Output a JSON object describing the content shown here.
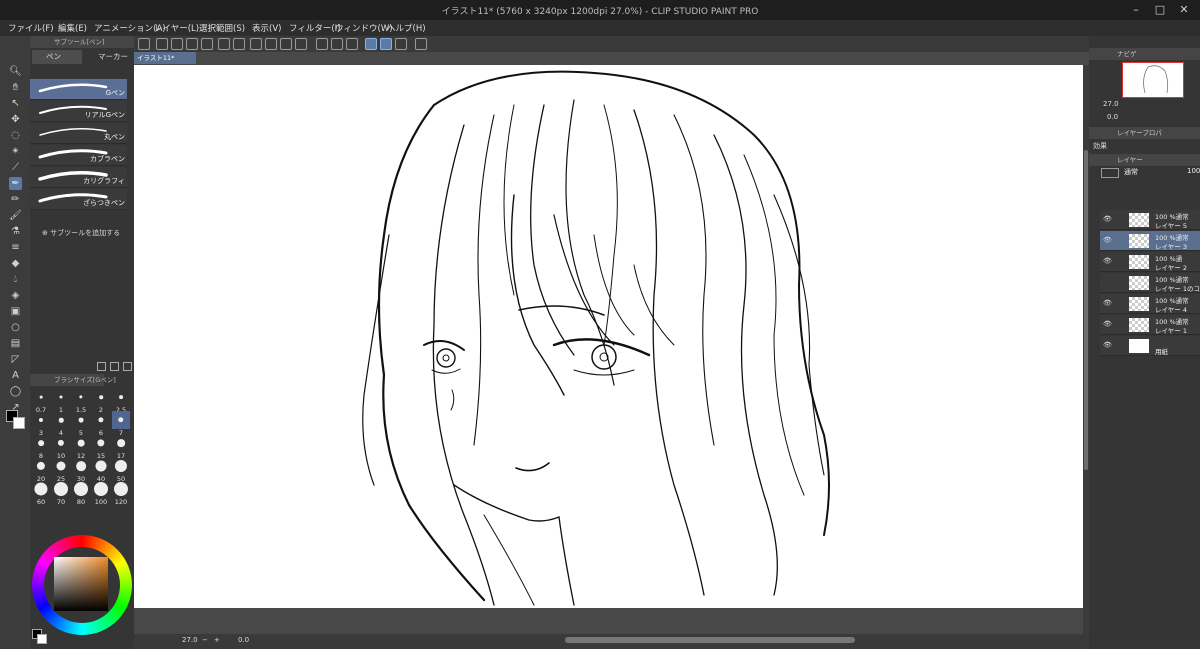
{
  "window": {
    "title": "イラスト11* (5760 x 3240px 1200dpi 27.0%) - CLIP STUDIO PAINT PRO"
  },
  "menu": [
    "ファイル(F)",
    "編集(E)",
    "アニメーション(A)",
    "レイヤー(L)",
    "選択範囲(S)",
    "表示(V)",
    "フィルター(I)",
    "ウィンドウ(W)",
    "ヘルプ(H)"
  ],
  "subtool_panel": {
    "header": "サブツール[ペン]",
    "tabs": [
      "ペン",
      "マーカー"
    ],
    "brushes": [
      "Gペン",
      "リアルGペン",
      "丸ペン",
      "カブラペン",
      "カリグラフィ",
      "ざらつきペン"
    ],
    "selected_brush": "Gペン",
    "add_label": "サブツールを追加する"
  },
  "brush_size_panel": {
    "header": "ブラシサイズ[Gペン]",
    "sizes": [
      "0.7",
      "1",
      "1.5",
      "2",
      "2.5",
      "3",
      "4",
      "5",
      "6",
      "7",
      "8",
      "10",
      "12",
      "15",
      "17",
      "20",
      "25",
      "30",
      "40",
      "50",
      "60",
      "70",
      "80",
      "100",
      "120"
    ],
    "selected": "7"
  },
  "canvas": {
    "tab_label": "イラスト11*",
    "content": "line drawing sketch"
  },
  "status_bar": {
    "zoom": "27.0",
    "rotation": "0.0"
  },
  "navigator": {
    "header": "ナビゲ",
    "zoom": "27.0",
    "rotation": "0.0"
  },
  "layer_property": {
    "header": "レイヤープロパ",
    "effect_label": "効果"
  },
  "layers_panel": {
    "header": "レイヤー",
    "blend_mode": "通常",
    "opacity": "100",
    "layers": [
      {
        "line1": "100 %通常",
        "line2": "レイヤー 5",
        "selected": false,
        "visible": true
      },
      {
        "line1": "100 %通常",
        "line2": "レイヤー 3",
        "selected": true,
        "visible": true
      },
      {
        "line1": "100 %通",
        "line2": "レイヤー 2",
        "selected": false,
        "visible": true
      },
      {
        "line1": "100 %通常",
        "line2": "レイヤー 1のコ",
        "selected": false,
        "visible": false
      },
      {
        "line1": "100 %通常",
        "line2": "レイヤー 4",
        "selected": false,
        "visible": true
      },
      {
        "line1": "100 %通常",
        "line2": "レイヤー 1",
        "selected": false,
        "visible": true
      },
      {
        "line1": "",
        "line2": "用紙",
        "selected": false,
        "visible": true,
        "paper": true
      }
    ]
  },
  "colors": {
    "accent": "#5b79a6",
    "selected_layer": "#5a6f8f",
    "canvas_bg": "#ffffff",
    "main_color": "#000000",
    "sub_color": "#ffffff"
  }
}
